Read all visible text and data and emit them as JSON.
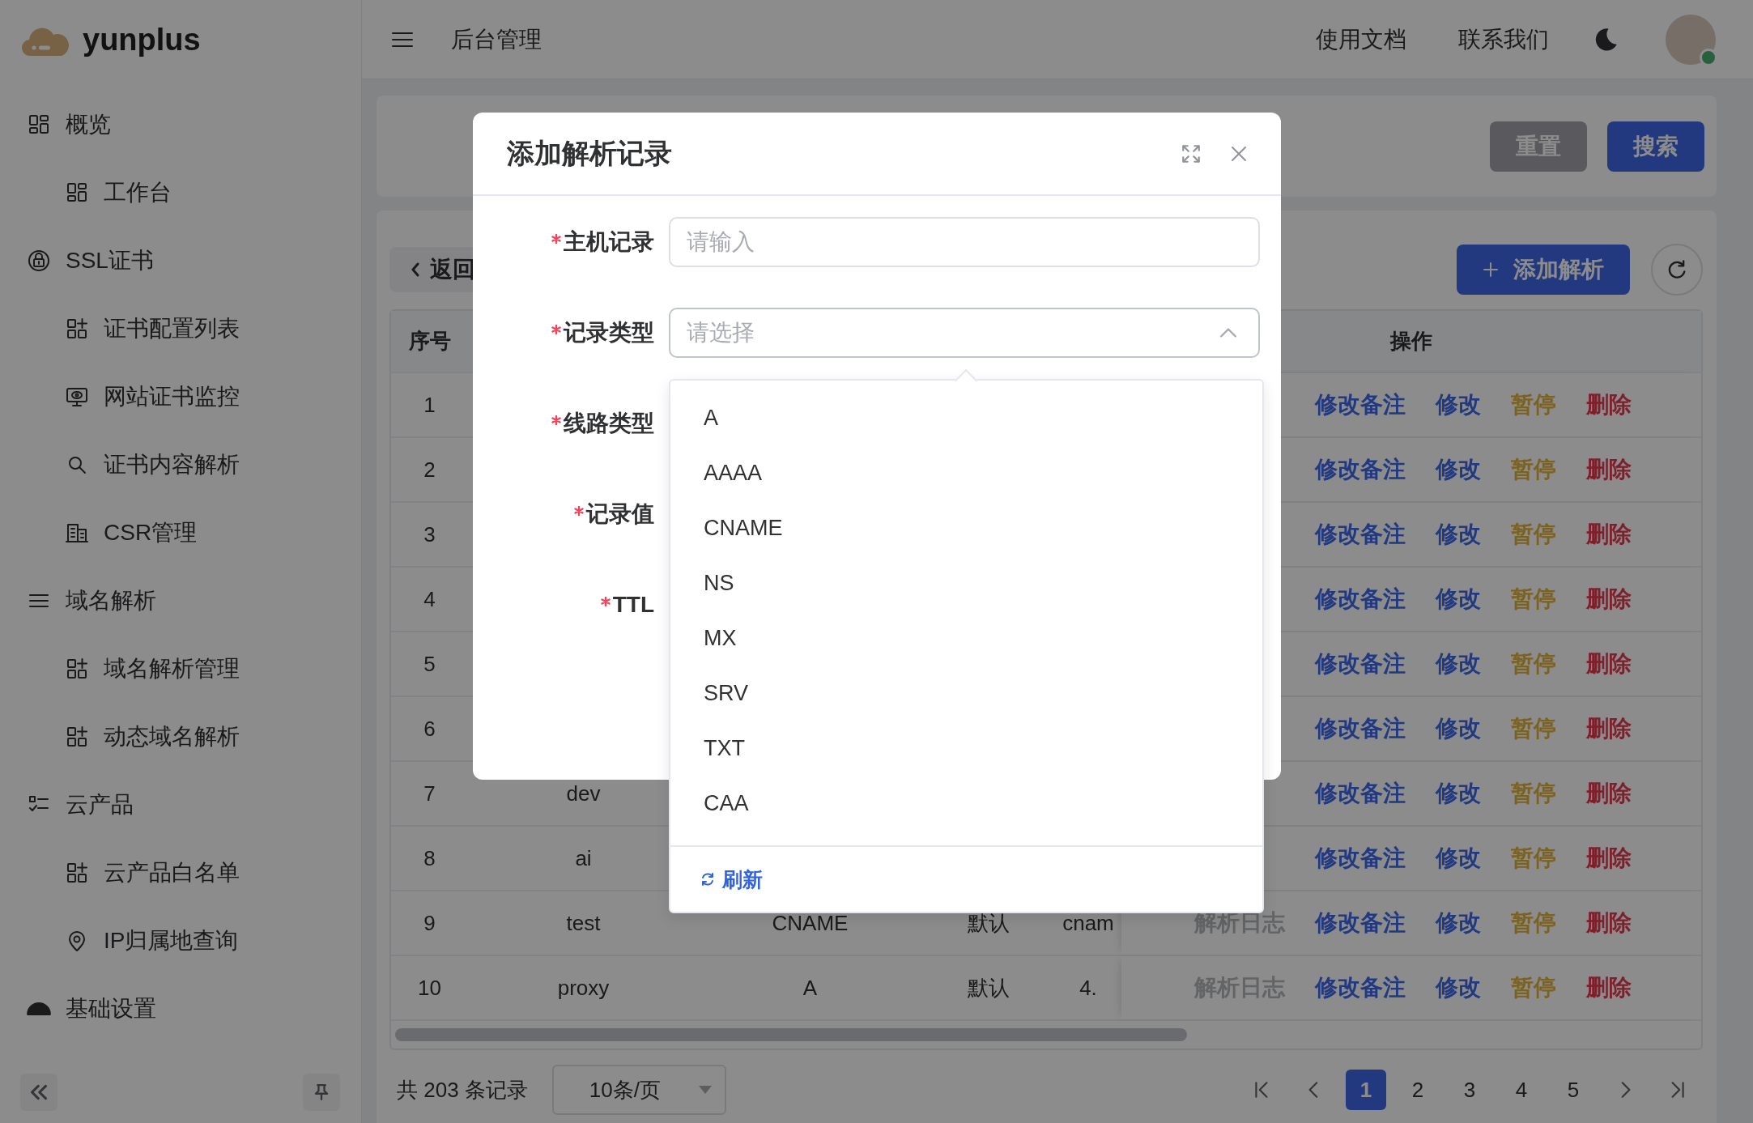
{
  "sidebar": {
    "logo": "yunplus",
    "menu": [
      {
        "label": "概览",
        "children": [
          {
            "label": "工作台"
          }
        ]
      },
      {
        "label": "SSL证书",
        "children": [
          {
            "label": "证书配置列表"
          },
          {
            "label": "网站证书监控"
          },
          {
            "label": "证书内容解析"
          },
          {
            "label": "CSR管理"
          }
        ]
      },
      {
        "label": "域名解析",
        "children": [
          {
            "label": "域名解析管理"
          },
          {
            "label": "动态域名解析"
          }
        ]
      },
      {
        "label": "云产品",
        "children": [
          {
            "label": "云产品白名单"
          },
          {
            "label": "IP归属地查询"
          }
        ]
      },
      {
        "label": "基础设置"
      }
    ]
  },
  "header": {
    "title": "后台管理",
    "links": [
      "使用文档",
      "联系我们"
    ]
  },
  "search_panel": {
    "buttons": [
      {
        "label": "重置",
        "kind": "secondary"
      },
      {
        "label": "搜索",
        "kind": "primary"
      }
    ]
  },
  "toolbar": {
    "back": "返回",
    "add": "添加解析"
  },
  "table": {
    "header": {
      "index": "序号",
      "actions": "操作"
    },
    "rows": [
      {
        "no": "1",
        "actions": [
          {
            "label": "修改备注",
            "kind": "link"
          },
          {
            "label": "修改",
            "kind": "link"
          },
          {
            "label": "暂停",
            "kind": "warning"
          },
          {
            "label": "删除",
            "kind": "danger"
          }
        ]
      },
      {
        "no": "2",
        "actions": [
          {
            "label": "修改备注",
            "kind": "link"
          },
          {
            "label": "修改",
            "kind": "link"
          },
          {
            "label": "暂停",
            "kind": "warning"
          },
          {
            "label": "删除",
            "kind": "danger"
          }
        ]
      },
      {
        "no": "3",
        "actions": [
          {
            "label": "修改备注",
            "kind": "link"
          },
          {
            "label": "修改",
            "kind": "link"
          },
          {
            "label": "暂停",
            "kind": "warning"
          },
          {
            "label": "删除",
            "kind": "danger"
          }
        ]
      },
      {
        "no": "4",
        "actions": [
          {
            "label": "修改备注",
            "kind": "link"
          },
          {
            "label": "修改",
            "kind": "link"
          },
          {
            "label": "暂停",
            "kind": "warning"
          },
          {
            "label": "删除",
            "kind": "danger"
          }
        ]
      },
      {
        "no": "5",
        "actions": [
          {
            "label": "修改备注",
            "kind": "link"
          },
          {
            "label": "修改",
            "kind": "link"
          },
          {
            "label": "暂停",
            "kind": "warning"
          },
          {
            "label": "删除",
            "kind": "danger"
          }
        ]
      },
      {
        "no": "6",
        "actions": [
          {
            "label": "修改备注",
            "kind": "link"
          },
          {
            "label": "修改",
            "kind": "link"
          },
          {
            "label": "暂停",
            "kind": "warning"
          },
          {
            "label": "删除",
            "kind": "danger"
          }
        ]
      },
      {
        "no": "7",
        "host": "dev",
        "actions": [
          {
            "label": "修改备注",
            "kind": "link"
          },
          {
            "label": "修改",
            "kind": "link"
          },
          {
            "label": "暂停",
            "kind": "warning"
          },
          {
            "label": "删除",
            "kind": "danger"
          }
        ]
      },
      {
        "no": "8",
        "host": "ai",
        "actions": [
          {
            "label": "修改备注",
            "kind": "link"
          },
          {
            "label": "修改",
            "kind": "link"
          },
          {
            "label": "暂停",
            "kind": "warning"
          },
          {
            "label": "删除",
            "kind": "danger"
          }
        ]
      },
      {
        "no": "9",
        "host": "test",
        "type": "CNAME",
        "line": "默认",
        "value": "cnam",
        "log": "解析日志",
        "actions": [
          {
            "label": "修改备注",
            "kind": "link"
          },
          {
            "label": "修改",
            "kind": "link"
          },
          {
            "label": "暂停",
            "kind": "warning"
          },
          {
            "label": "删除",
            "kind": "danger"
          }
        ]
      },
      {
        "no": "10",
        "host": "proxy",
        "type": "A",
        "line": "默认",
        "value": "4.",
        "log": "解析日志",
        "actions": [
          {
            "label": "修改备注",
            "kind": "link"
          },
          {
            "label": "修改",
            "kind": "link"
          },
          {
            "label": "暂停",
            "kind": "warning"
          },
          {
            "label": "删除",
            "kind": "danger"
          }
        ]
      }
    ]
  },
  "pagination": {
    "total": "共 203 条记录",
    "page_size": "10条/页",
    "pages": [
      {
        "label": "1",
        "selected": true
      },
      {
        "label": "2",
        "selected": false
      },
      {
        "label": "3",
        "selected": false
      },
      {
        "label": "4",
        "selected": false
      },
      {
        "label": "5",
        "selected": false
      }
    ]
  },
  "dialog": {
    "title": "添加解析记录",
    "fields": [
      {
        "label": "主机记录",
        "required": true,
        "kind": "input",
        "placeholder": "请输入"
      },
      {
        "label": "记录类型",
        "required": true,
        "kind": "select",
        "placeholder": "请选择",
        "expanded": true
      },
      {
        "label": "线路类型",
        "required": true
      },
      {
        "label": "记录值",
        "required": true
      },
      {
        "label": "TTL",
        "required": true
      }
    ],
    "dropdown": {
      "options": [
        "A",
        "AAAA",
        "CNAME",
        "NS",
        "MX",
        "SRV",
        "TXT",
        "CAA"
      ],
      "footer": "刷新"
    }
  }
}
